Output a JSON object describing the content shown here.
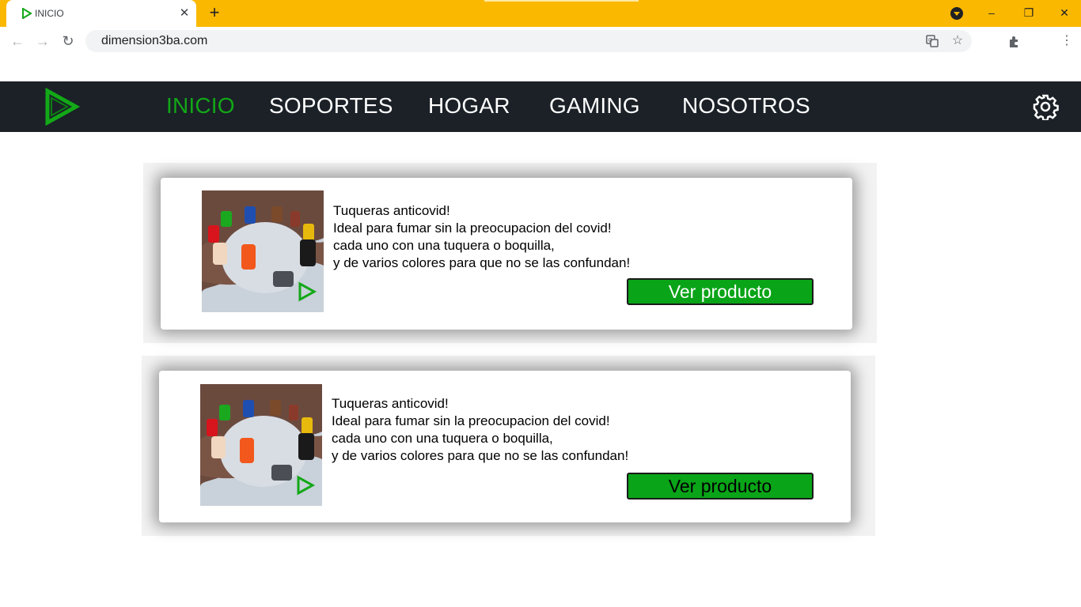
{
  "browser": {
    "tab_title": "INICIO",
    "tab_close": "✕",
    "new_tab": "+",
    "url": "dimension3ba.com",
    "window_buttons": {
      "minimize": "–",
      "restore": "❐",
      "close": "✕"
    },
    "nav": {
      "back": "←",
      "forward": "→",
      "reload": "↻"
    },
    "icons": [
      "translate-icon",
      "star-icon",
      "extensions-icon",
      "menu-icon"
    ],
    "colors": {
      "tabbar": "#fbb800"
    }
  },
  "site": {
    "nav_items": [
      "INICIO",
      "SOPORTES",
      "HOGAR",
      "GAMING",
      "NOSOTROS"
    ],
    "active_item": "INICIO",
    "colors": {
      "nav_bg": "#1b2127",
      "accent": "#12a817",
      "button": "#0aa418"
    }
  },
  "products": [
    {
      "lines": [
        "Tuqueras anticovid!",
        "Ideal para fumar sin la preocupacion del covid!",
        "cada uno con una tuquera o boquilla,",
        "y de varios colores para que no se las confundan!"
      ],
      "button": "Ver producto",
      "button_text_color": "#ffffff"
    },
    {
      "lines": [
        "Tuqueras anticovid!",
        "Ideal para fumar sin la preocupacion del covid!",
        "cada uno con una tuquera o boquilla,",
        "y de varios colores para que no se las confundan!"
      ],
      "button": "Ver producto",
      "button_text_color": "#000000"
    }
  ]
}
